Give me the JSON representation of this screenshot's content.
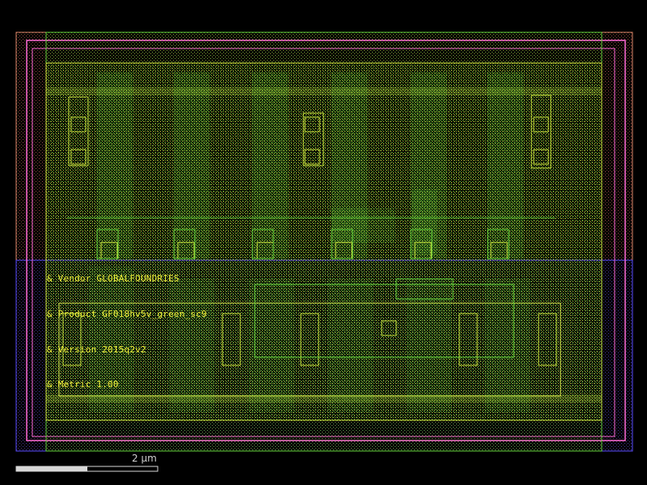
{
  "layout_labels": [
    "& Vendor GLOBALFOUNDRIES",
    "& Product GF018hv5v_green_sc9",
    "& Version 2015q2v2",
    "& Metric 1.00"
  ],
  "scale_bar": {
    "label": "2  μm"
  },
  "colors": {
    "background": "#000000",
    "nwell": "#e08a6a",
    "pwell": "#5a4cff",
    "boundary_pink": "#ff6ad5",
    "diffusion": "#63d23a",
    "poly": "#c9e23a",
    "metal": "#bfe33a",
    "text": "#f2f23a"
  }
}
